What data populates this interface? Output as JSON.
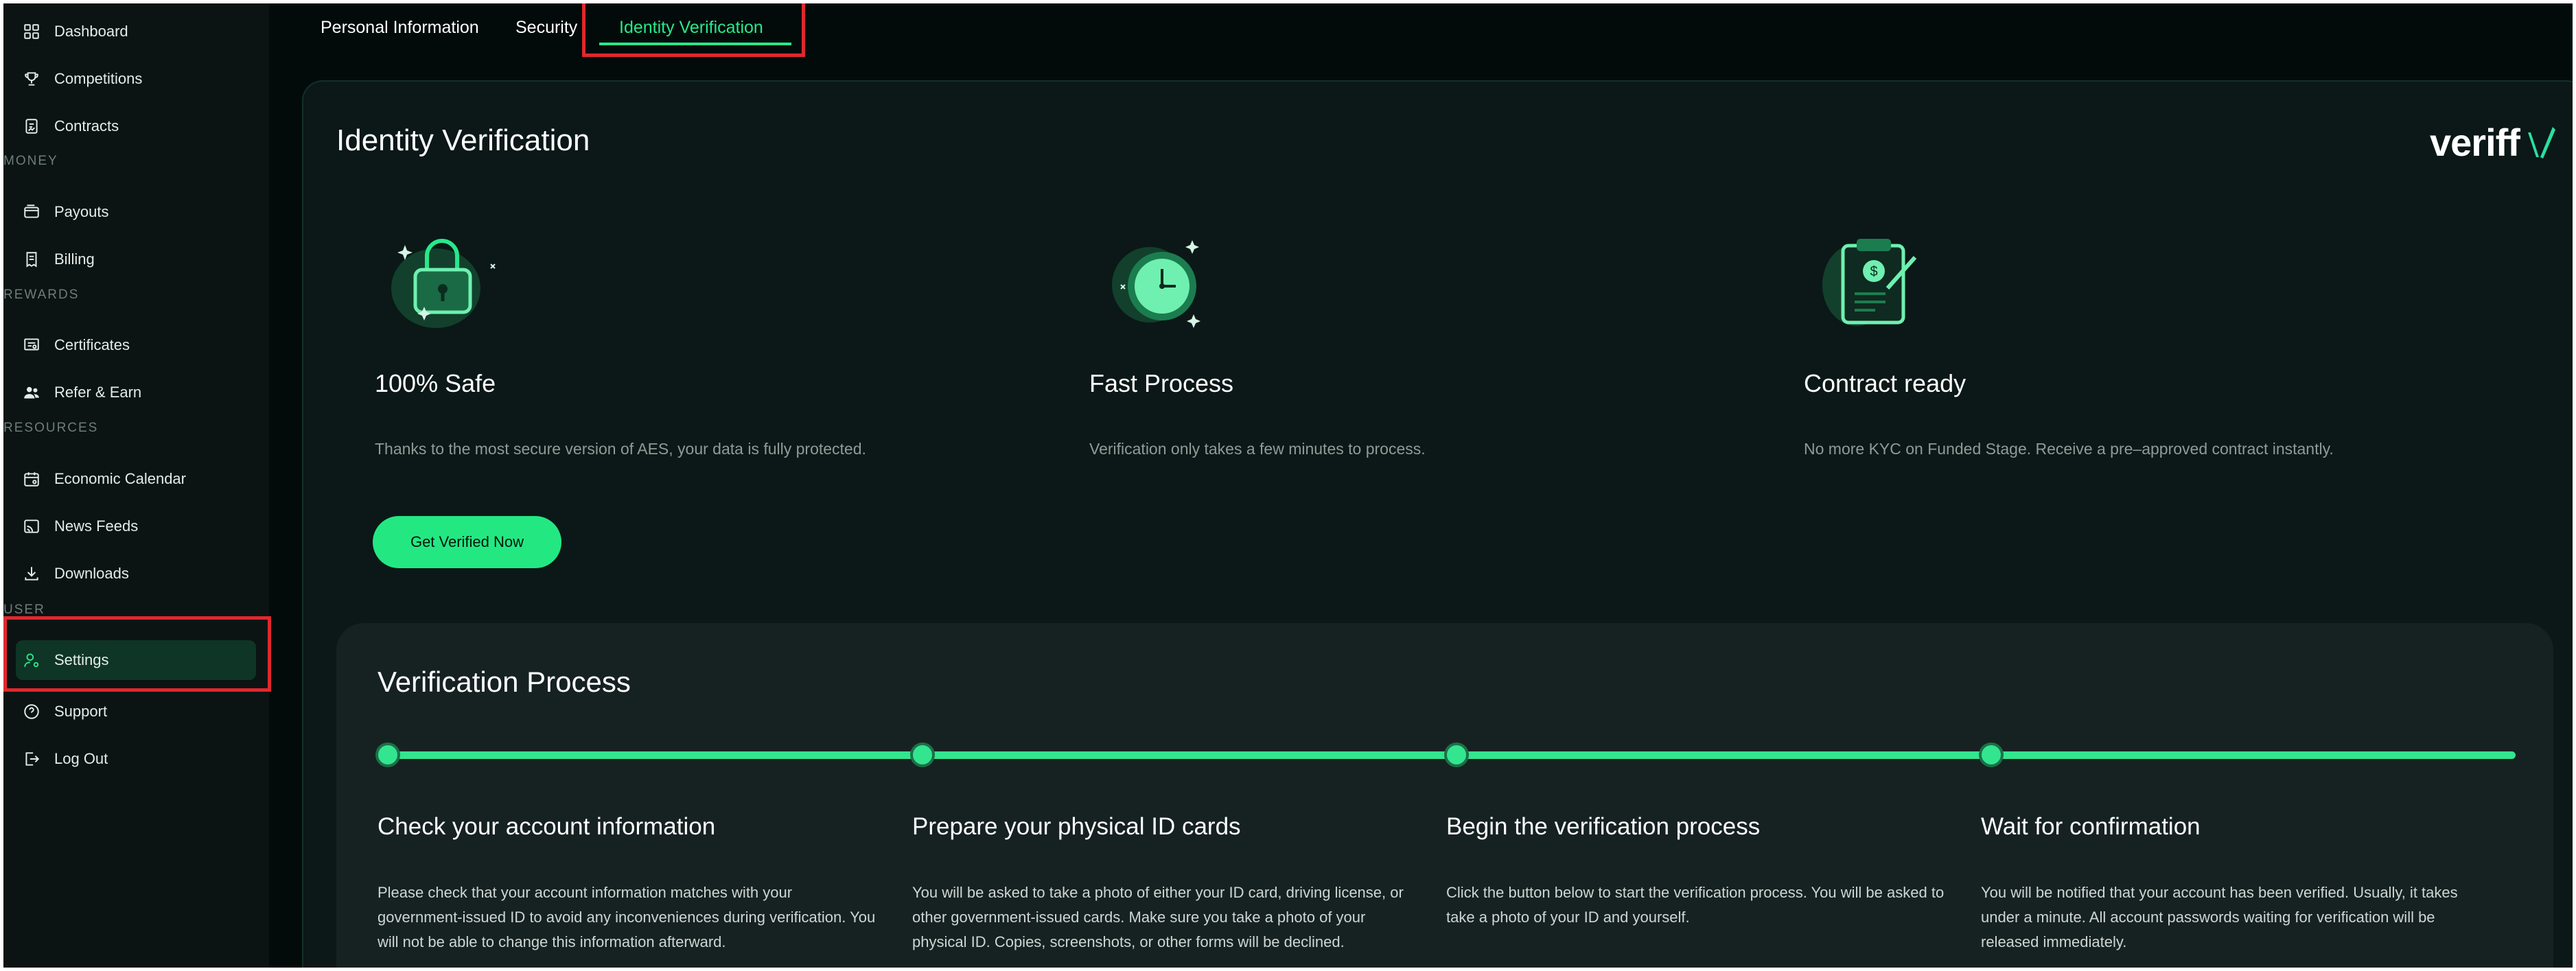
{
  "sidebar": {
    "items": [
      {
        "label": "Dashboard",
        "icon": "grid-icon"
      },
      {
        "label": "Competitions",
        "icon": "trophy-icon"
      },
      {
        "label": "Contracts",
        "icon": "contract-icon"
      },
      {
        "label": "Payouts",
        "icon": "wallet-icon"
      },
      {
        "label": "Billing",
        "icon": "receipt-icon"
      },
      {
        "label": "Certificates",
        "icon": "certificate-icon"
      },
      {
        "label": "Refer & Earn",
        "icon": "users-icon"
      },
      {
        "label": "Economic Calendar",
        "icon": "calendar-icon"
      },
      {
        "label": "News Feeds",
        "icon": "rss-icon"
      },
      {
        "label": "Downloads",
        "icon": "download-icon"
      },
      {
        "label": "Settings",
        "icon": "user-gear-icon"
      },
      {
        "label": "Support",
        "icon": "help-icon"
      },
      {
        "label": "Log Out",
        "icon": "logout-icon"
      }
    ],
    "sections": [
      "MONEY",
      "REWARDS",
      "RESOURCES",
      "USER"
    ],
    "active": "Settings"
  },
  "tabs": [
    {
      "label": "Personal Information"
    },
    {
      "label": "Security"
    },
    {
      "label": "Identity Verification"
    }
  ],
  "card": {
    "title": "Identity Verification",
    "brand": "veriff",
    "features": [
      {
        "title": "100% Safe",
        "desc": "Thanks to the most secure version of AES, your data is fully protected.",
        "icon": "lock-icon"
      },
      {
        "title": "Fast Process",
        "desc": "Verification only takes a few minutes to process.",
        "icon": "clock-icon"
      },
      {
        "title": "Contract ready",
        "desc": "No more KYC on Funded Stage. Receive a pre–approved contract instantly.",
        "icon": "clipboard-contract-icon"
      }
    ],
    "cta": "Get Verified Now"
  },
  "process": {
    "title": "Verification Process",
    "steps": [
      {
        "title": "Check your account information",
        "desc": "Please check that your account information matches with your government-issued ID to avoid any inconveniences during verification. You will not be able to change this information afterward."
      },
      {
        "title": "Prepare your physical ID cards",
        "desc": "You will be asked to take a photo of either your ID card, driving license, or other government-issued cards. Make sure you take a photo of your physical ID. Copies, screenshots, or other forms will be declined."
      },
      {
        "title": "Begin the verification process",
        "desc": "Click the button below to start the verification process. You will be asked to take a photo of your ID and yourself."
      },
      {
        "title": "Wait for confirmation",
        "desc": "You will be notified that your account has been verified. Usually, it takes under a minute. All account passwords waiting for verification will be released immediately."
      }
    ]
  },
  "colors": {
    "accent": "#27e88a",
    "background": "#020b0a",
    "sidebar": "#0b1413",
    "highlight": "#e0282e"
  }
}
